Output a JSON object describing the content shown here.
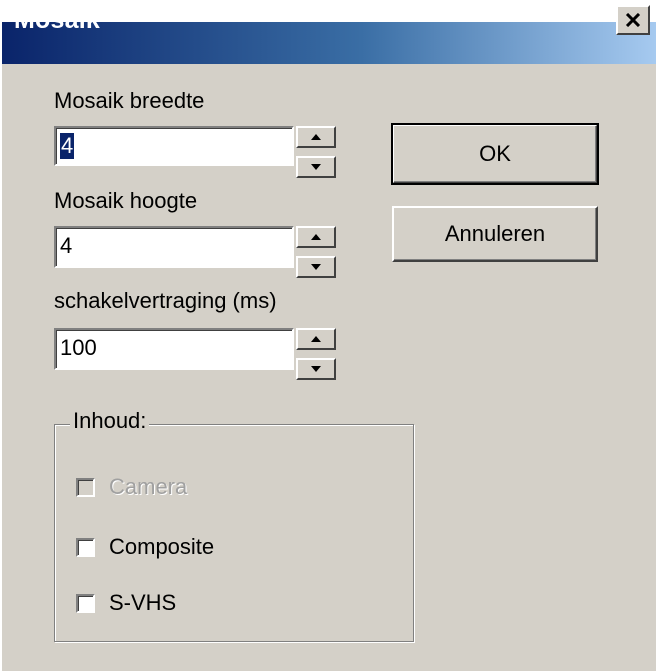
{
  "window": {
    "title": "Mosaik",
    "close_icon": "close-icon"
  },
  "fields": {
    "width": {
      "label": "Mosaik breedte",
      "value": "4"
    },
    "height": {
      "label": "Mosaik hoogte",
      "value": "4"
    },
    "delay": {
      "label": "schakelvertraging (ms)",
      "value": "100"
    }
  },
  "buttons": {
    "ok": "OK",
    "cancel": "Annuleren"
  },
  "content_group": {
    "label": "Inhoud:",
    "items": [
      {
        "label": "Camera",
        "checked": false,
        "enabled": false
      },
      {
        "label": "Composite",
        "checked": false,
        "enabled": true
      },
      {
        "label": "S-VHS",
        "checked": false,
        "enabled": true
      }
    ]
  },
  "colors": {
    "face": "#d4d0c8",
    "title_start": "#0a246a",
    "title_end": "#a6caf0",
    "selection": "#0a246a"
  }
}
